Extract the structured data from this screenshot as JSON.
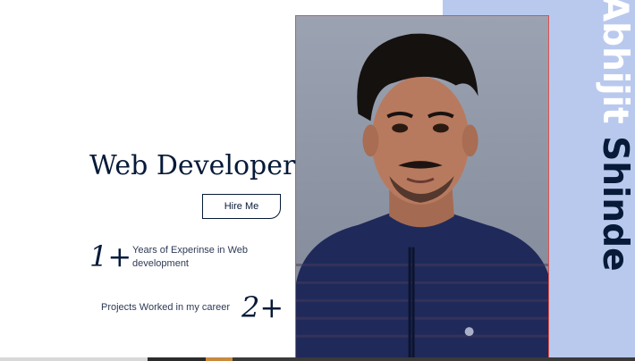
{
  "profile": {
    "first_name": "Abhijit",
    "last_name": "Shinde",
    "role": "Web Developer",
    "hire_label": "Hire Me"
  },
  "stats": [
    {
      "number": "1+",
      "text": "Years of Experinse in Web development"
    },
    {
      "number": "2+",
      "text": "Projects Worked in my career"
    }
  ],
  "colors": {
    "primary": "#071a38",
    "panel": "#b9c9ee",
    "photo_border": "#d9534f"
  },
  "photo": {
    "icon": "portrait-photo"
  }
}
